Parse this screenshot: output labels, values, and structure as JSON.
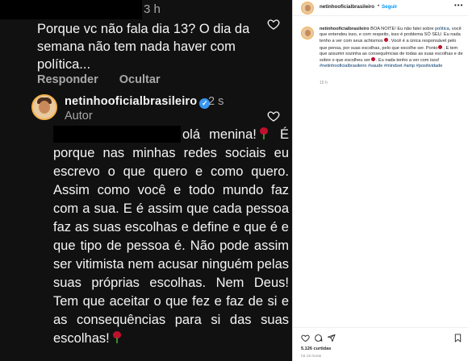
{
  "comment_thread": {
    "first_comment": {
      "time": "3 h",
      "text": "Porque vc não fala dia 13? O dia da semana não tem nada haver com política...",
      "reply_label": "Responder",
      "hide_label": "Ocultar"
    },
    "author_reply": {
      "username": "netinhooficialbrasileiro",
      "time": "2 s",
      "role": "Autor",
      "text_1": "olá menina!",
      "text_2": "É porque nas minhas redes sociais eu escrevo o que quero e como quero. Assim como você e todo mundo faz com a sua. E é assim que cada pessoa faz as suas escolhas e define e que é e que tipo de pessoa é. Não pode assim ser vitimista nem acusar ninguém pelas suas próprias escolhas. Nem Deus! Tem que aceitar o que fez e faz de si e as consequências para si das suas escolhas!"
    }
  },
  "post": {
    "username": "netinhooficialbrasileiro",
    "follow_label": "Seguir",
    "more_label": "•••",
    "caption": {
      "username": "netinhooficialbrasileiro",
      "part_1": "BOA NOITE! Eu não falei sobre",
      "link_word": "política",
      "part_2": ", você que entendeu isso, e com respeito, isso é problema SÓ SEU. Eu nada tenho a ver com seus achismos",
      "part_3": ". Você é a única responsável pelo que pensa, por suas escolhas, pelo que escolhe ser. Ponto",
      "part_4": ". E tem que assumir sozinha as consequências de todas as suas escolhas e de sobre o que escolheu ser",
      "part_5": ". Eu nada tenho a ver com isso!",
      "hashtags": "#netinhooficialbrasileiro #saude #mindset #amp #positividade"
    },
    "age": "15 h",
    "likes": "5.126 curtidas",
    "posted_ago": "há 15 horas"
  },
  "icons": {
    "heart": "heart-icon",
    "comment": "comment-icon",
    "share": "share-icon",
    "save": "bookmark-icon",
    "rose": "rose-emoji-icon",
    "verified": "verified-badge-icon"
  },
  "colors": {
    "dark_bg": "#111111",
    "muted_text": "#a8a8a8",
    "verified_blue": "#3897f0",
    "follow_blue": "#0095f6",
    "link_blue": "#00376b"
  }
}
